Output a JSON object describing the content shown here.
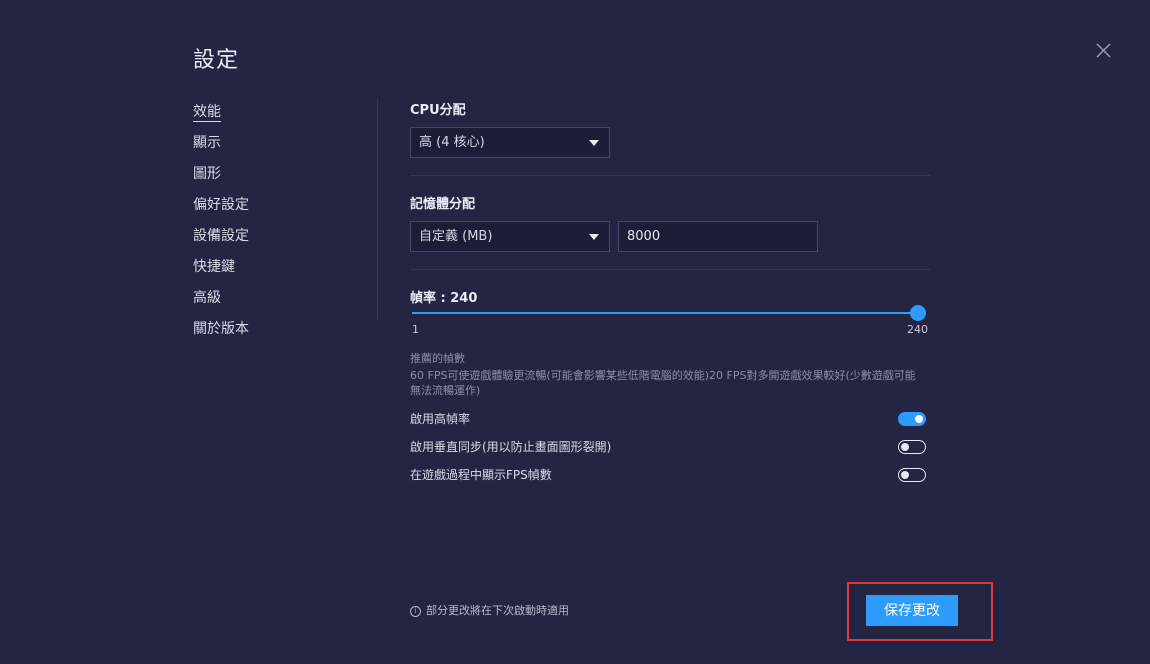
{
  "window": {
    "title": "設定"
  },
  "sidebar": {
    "items": [
      {
        "label": "效能",
        "active": true
      },
      {
        "label": "顯示"
      },
      {
        "label": "圖形"
      },
      {
        "label": "偏好設定"
      },
      {
        "label": "設備設定"
      },
      {
        "label": "快捷鍵"
      },
      {
        "label": "高級"
      },
      {
        "label": "關於版本"
      }
    ]
  },
  "cpu": {
    "title": "CPU分配",
    "selected": "高 (4 核心)"
  },
  "memory": {
    "title": "記憶體分配",
    "selected": "自定義 (MB)",
    "value": "8000"
  },
  "framerate": {
    "label": "幀率 : 240",
    "value": 240,
    "min": 1,
    "max": 240,
    "min_label": "1",
    "max_label": "240",
    "recommend_title": "推薦的幀數",
    "recommend_text": "60 FPS可使遊戲體驗更流暢(可能會影響某些低階電腦的效能)20 FPS對多開遊戲效果較好(少數遊戲可能無法流暢運作)"
  },
  "toggles": [
    {
      "label": "啟用高幀率",
      "on": true
    },
    {
      "label": "啟用垂直同步(用以防止畫面圖形裂開)",
      "on": false
    },
    {
      "label": "在遊戲過程中顯示FPS幀數",
      "on": false
    }
  ],
  "footer": {
    "notice": "部分更改將在下次啟動時適用",
    "save_label": "保存更改"
  },
  "colors": {
    "background": "#232543",
    "accent": "#2e9bff",
    "highlight": "#e0383e"
  }
}
